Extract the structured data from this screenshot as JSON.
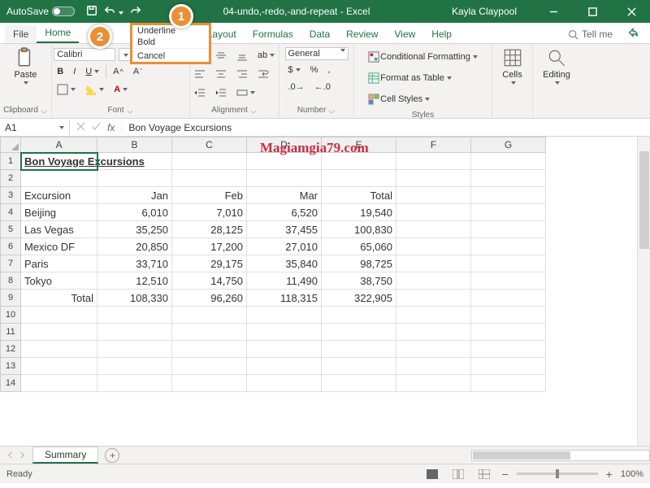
{
  "titlebar": {
    "autosave_label": "AutoSave",
    "filename": "04-undo,-redo,-and-repeat - Excel",
    "user": "Kayla Claypool"
  },
  "undo_menu": {
    "items": [
      "Underline",
      "Bold"
    ],
    "cancel": "Cancel"
  },
  "tabs": {
    "file": "File",
    "home": "Home",
    "page_layout": "age Layout",
    "formulas": "Formulas",
    "data": "Data",
    "review": "Review",
    "view": "View",
    "help": "Help",
    "tellme": "Tell me"
  },
  "ribbon": {
    "clipboard": {
      "label": "Clipboard",
      "paste": "Paste"
    },
    "font": {
      "label": "Font",
      "name": "Calibri",
      "bold": "B",
      "italic": "I",
      "underline": "U"
    },
    "alignment": {
      "label": "Alignment"
    },
    "number": {
      "label": "Number",
      "format": "General"
    },
    "styles": {
      "label": "Styles",
      "cond": "Conditional Formatting",
      "table": "Format as Table",
      "cell": "Cell Styles"
    },
    "cells": {
      "label": "Cells"
    },
    "editing": {
      "label": "Editing"
    }
  },
  "fbar": {
    "ref": "A1",
    "value": "Bon Voyage Excursions"
  },
  "columns": [
    "A",
    "B",
    "C",
    "D",
    "E",
    "F",
    "G"
  ],
  "rows": [
    1,
    2,
    3,
    4,
    5,
    6,
    7,
    8,
    9,
    10,
    11,
    12,
    13,
    14
  ],
  "data": {
    "r1": {
      "A": "Bon Voyage Excursions"
    },
    "r3": {
      "A": "Excursion",
      "B": "Jan",
      "C": "Feb",
      "D": "Mar",
      "E": "Total"
    },
    "r4": {
      "A": "Beijing",
      "B": "6,010",
      "C": "7,010",
      "D": "6,520",
      "E": "19,540"
    },
    "r5": {
      "A": "Las Vegas",
      "B": "35,250",
      "C": "28,125",
      "D": "37,455",
      "E": "100,830"
    },
    "r6": {
      "A": "Mexico DF",
      "B": "20,850",
      "C": "17,200",
      "D": "27,010",
      "E": "65,060"
    },
    "r7": {
      "A": "Paris",
      "B": "33,710",
      "C": "29,175",
      "D": "35,840",
      "E": "98,725"
    },
    "r8": {
      "A": "Tokyo",
      "B": "12,510",
      "C": "14,750",
      "D": "11,490",
      "E": "38,750"
    },
    "r9": {
      "A": "Total",
      "B": "108,330",
      "C": "96,260",
      "D": "118,315",
      "E": "322,905"
    }
  },
  "watermark": "Magiamgia79.com",
  "sheet": {
    "name": "Summary"
  },
  "status": {
    "ready": "Ready",
    "zoom": "100%"
  },
  "callouts": {
    "c1": "1",
    "c2": "2"
  }
}
